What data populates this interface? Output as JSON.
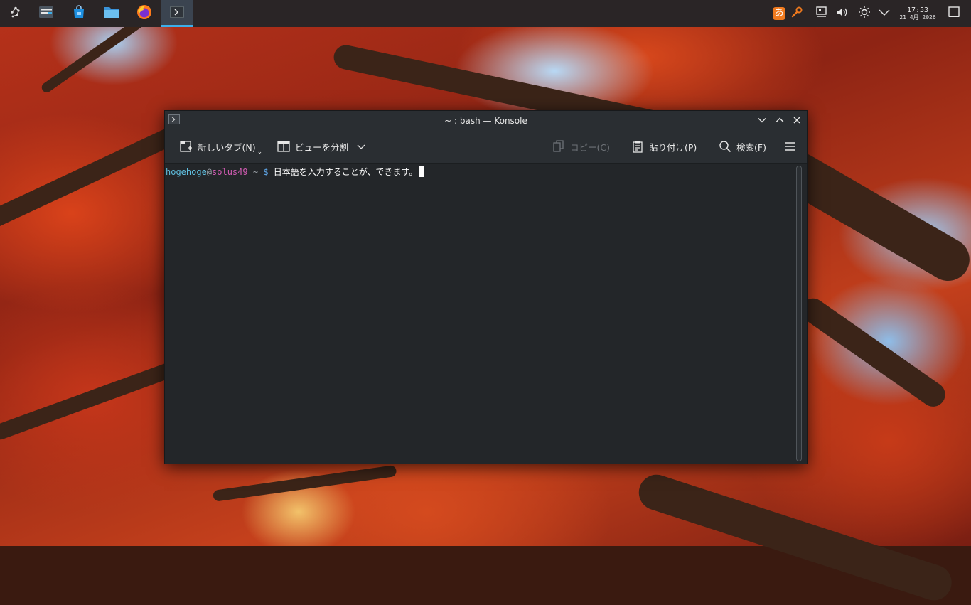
{
  "taskbar": {
    "launcher_icon": "kickoff-launcher-icon",
    "tasks": [
      {
        "name": "system-settings",
        "icon": "settings-panel-icon"
      },
      {
        "name": "software-center",
        "icon": "shopping-bag-icon"
      },
      {
        "name": "file-manager",
        "icon": "folder-icon"
      },
      {
        "name": "firefox",
        "icon": "firefox-icon"
      },
      {
        "name": "konsole",
        "icon": "terminal-icon",
        "active": true
      }
    ],
    "tray": {
      "ime_label": "あ",
      "clock_time": "17:53",
      "clock_date": "21 4月 2026"
    },
    "colors": {
      "panel_bg": "#2a2526",
      "active_indicator": "#3daee9",
      "ime_bg": "#f07a1e"
    }
  },
  "window": {
    "title": "~ : bash — Konsole",
    "toolbar": {
      "new_tab": "新しいタブ(N)",
      "split_view": "ビューを分割",
      "copy": "コピー(C)",
      "paste": "貼り付け(P)",
      "find": "検索(F)"
    },
    "terminal": {
      "user": "hogehoge",
      "at": "@",
      "host": "solus49",
      "cwd": "~",
      "prompt_symbol": "$",
      "command": "日本語を入力することが、できます。"
    },
    "colors": {
      "bg": "#232629",
      "user": "#5fbfe0",
      "host": "#d35cb4",
      "prompt": "#5fa6e8"
    }
  }
}
